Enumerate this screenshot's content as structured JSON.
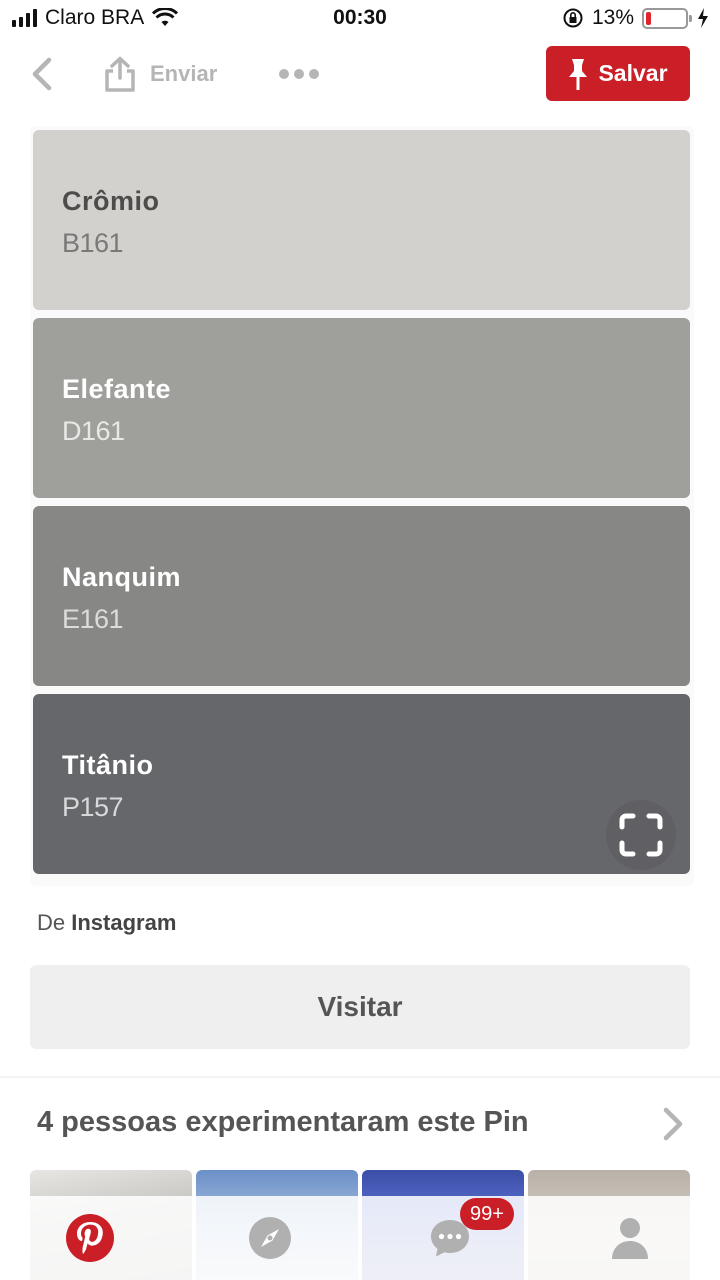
{
  "status_bar": {
    "carrier": "Claro BRA",
    "time": "00:30",
    "battery_percent": "13%",
    "battery_level": 0.13
  },
  "top_nav": {
    "send_label": "Enviar",
    "save_label": "Salvar"
  },
  "swatches": [
    {
      "name": "Crômio",
      "code": "B161",
      "color": "#d2d1ce",
      "text_color": "#4d4c4a",
      "code_color": "#7a7977"
    },
    {
      "name": "Elefante",
      "code": "D161",
      "color": "#9f9f9b",
      "text_color": "#ffffff",
      "code_color": "#e8e8e6"
    },
    {
      "name": "Nanquim",
      "code": "E161",
      "color": "#878885",
      "text_color": "#ffffff",
      "code_color": "#dcdcdb"
    },
    {
      "name": "Titânio",
      "code": "P157",
      "color": "#66676b",
      "text_color": "#ffffff",
      "code_color": "#d8d8da"
    }
  ],
  "source": {
    "prefix": "De",
    "name": "Instagram"
  },
  "visit_label": "Visitar",
  "tried": {
    "title": "4 pessoas experimentaram este Pin"
  },
  "tab_bar": {
    "messages_badge": "99+"
  },
  "colors": {
    "brand_red": "#cb1f27",
    "icon_gray": "#b5b5b5"
  }
}
